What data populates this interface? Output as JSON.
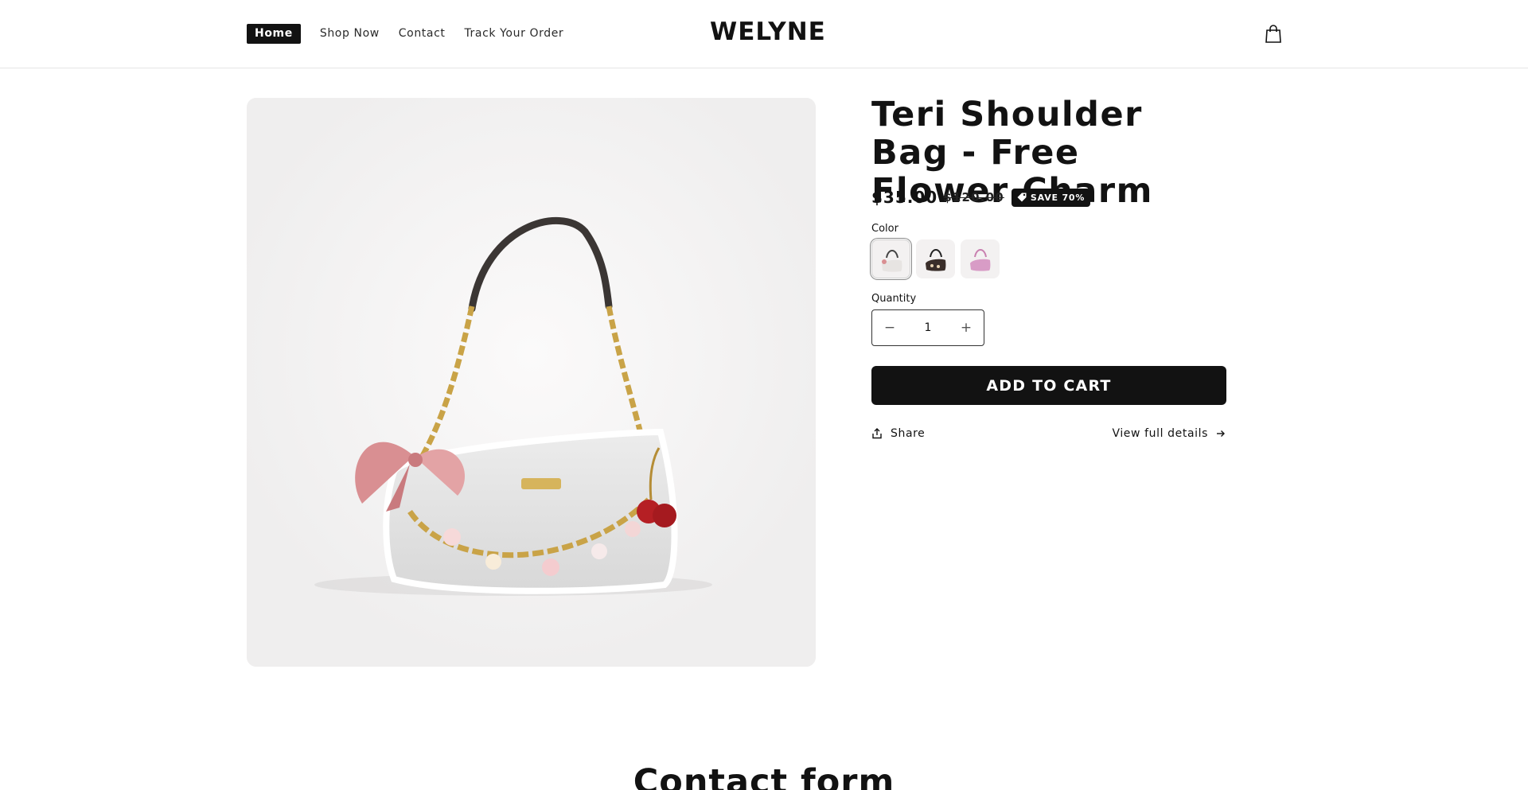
{
  "header": {
    "nav": [
      {
        "label": "Home",
        "active": true
      },
      {
        "label": "Shop Now"
      },
      {
        "label": "Contact"
      },
      {
        "label": "Track Your Order"
      }
    ],
    "logo": "WELYNE",
    "cart_icon": "shopping-bag-icon"
  },
  "product": {
    "title": "Teri Shoulder Bag - Free Flower Charm",
    "price": "$35.00",
    "compare_price": "$120.00",
    "badge": "SAVE 70%",
    "badge_icon": "tag-icon",
    "color_label": "Color",
    "colors": [
      "cream",
      "brown",
      "pink"
    ],
    "quantity_label": "Quantity",
    "quantity": "1",
    "add_to_cart": "ADD TO CART",
    "share": "Share",
    "view_details": "View full details"
  },
  "contact": {
    "title": "Contact form"
  },
  "colors": {
    "primary": "#121212",
    "media_bg": "#f1f0f0",
    "border": "#e6e6e6"
  }
}
